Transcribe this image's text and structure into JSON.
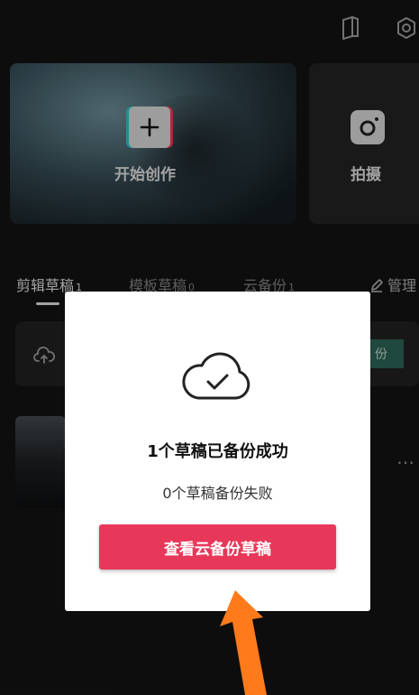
{
  "header": {
    "icons": [
      "book-icon",
      "gear-icon"
    ]
  },
  "cards": {
    "create_label": "开始创作",
    "shoot_label": "拍摄"
  },
  "tabs": [
    {
      "label": "剪辑草稿",
      "count": "1"
    },
    {
      "label": "模板草稿",
      "count": "0"
    },
    {
      "label": "云备份",
      "count": "1"
    }
  ],
  "manage_label": "管理",
  "backup": {
    "button_label": "份"
  },
  "modal": {
    "title": "1个草稿已备份成功",
    "subtitle": "0个草稿备份失败",
    "button_label": "查看云备份草稿"
  },
  "colors": {
    "accent": "#e8385a",
    "annotation_arrow": "#ff7a1a"
  }
}
